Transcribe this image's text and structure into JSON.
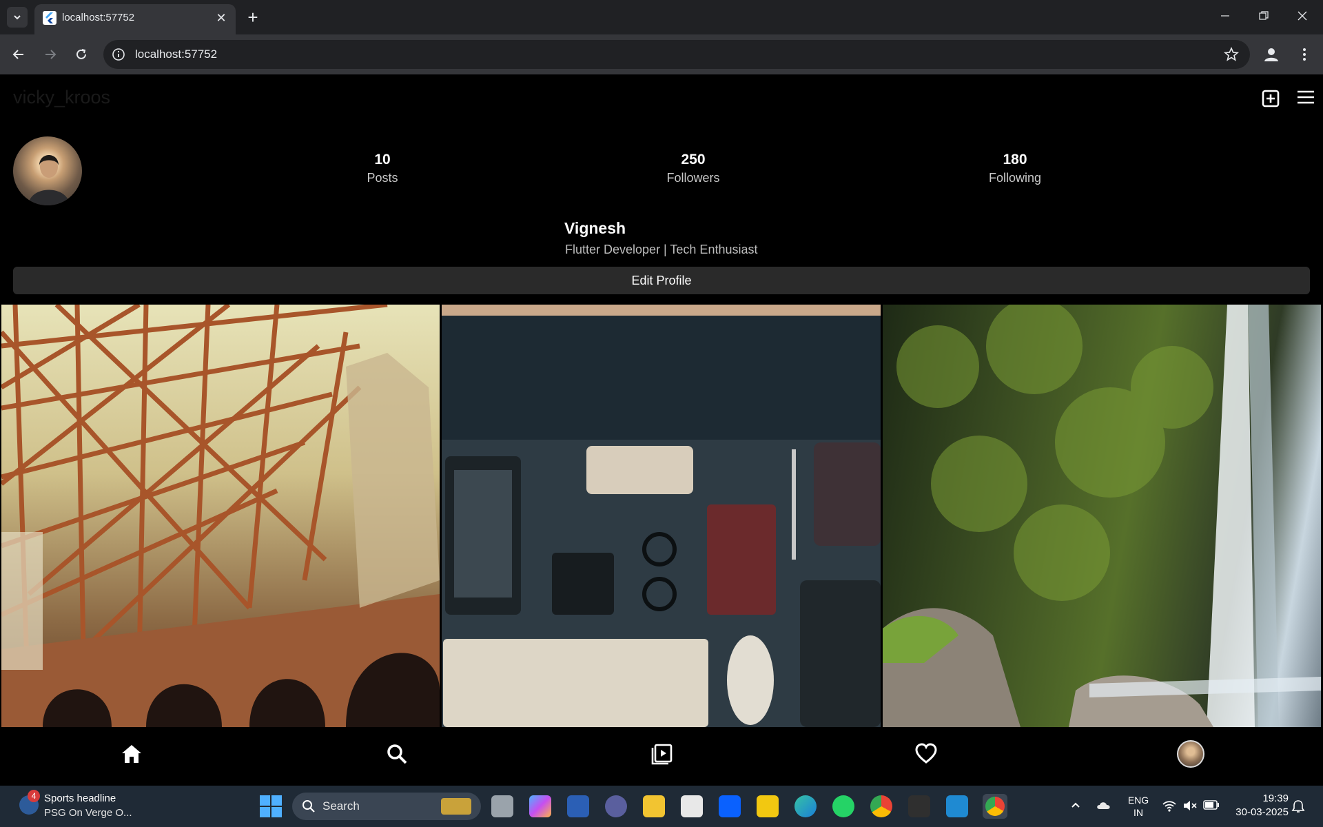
{
  "browser": {
    "tab_title": "localhost:57752",
    "url": "localhost:57752"
  },
  "profile": {
    "username": "vicky_kroos",
    "posts_count": "10",
    "posts_label": "Posts",
    "followers_count": "250",
    "followers_label": "Followers",
    "following_count": "180",
    "following_label": "Following",
    "name": "Vignesh",
    "bio": "Flutter Developer | Tech Enthusiast",
    "edit_button_label": "Edit Profile"
  },
  "grid": {
    "tiles": [
      "steel-structure-photo",
      "desk-setup-photo",
      "waterfall-photo"
    ]
  },
  "taskbar": {
    "news_title": "Sports headline",
    "news_subtitle": "PSG On Verge O...",
    "news_badge": "4",
    "search_placeholder": "Search",
    "lang_line1": "ENG",
    "lang_line2": "IN",
    "time": "19:39",
    "date": "30-03-2025"
  },
  "colors": {
    "background": "#000000",
    "edit_button": "#2a2a2a",
    "browser_toolbar": "#35363a",
    "taskbar": "#1f2a36"
  }
}
